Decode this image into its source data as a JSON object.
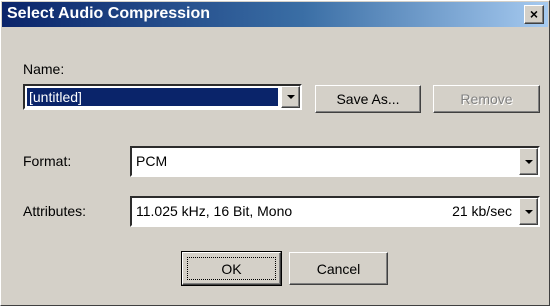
{
  "window": {
    "title": "Select Audio Compression",
    "close_label": "×"
  },
  "name_section": {
    "label": "Name:",
    "value": "[untitled]",
    "save_as_label": "Save As...",
    "remove_label": "Remove"
  },
  "format": {
    "label": "Format:",
    "value": "PCM"
  },
  "attributes": {
    "label": "Attributes:",
    "value": "11.025 kHz, 16 Bit, Mono",
    "rate": "21 kb/sec"
  },
  "buttons": {
    "ok_label": "OK",
    "cancel_label": "Cancel"
  }
}
